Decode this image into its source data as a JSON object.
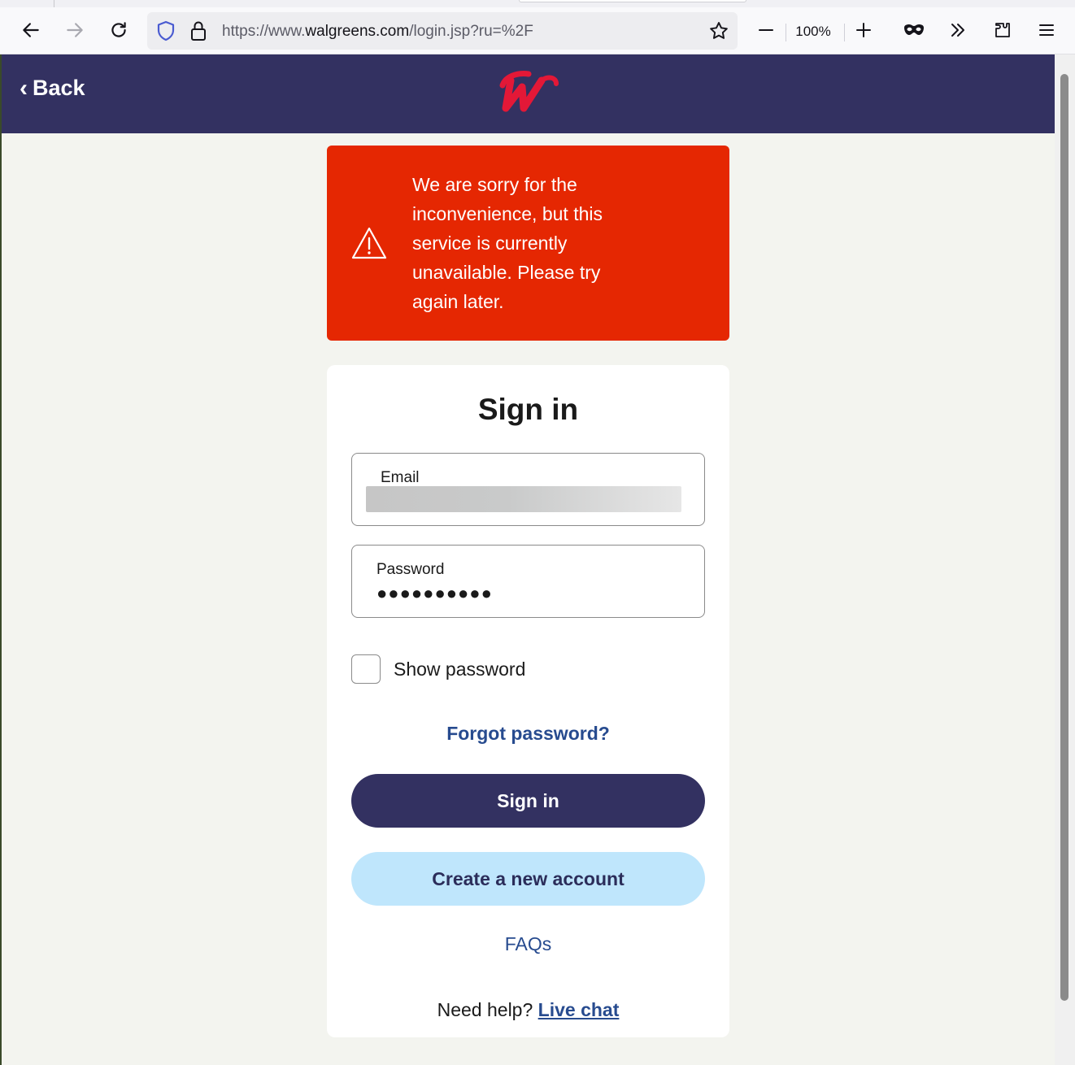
{
  "browser": {
    "url_prefix": "https://www.",
    "url_host": "walgreens.com",
    "url_path": "/login.jsp?ru=%2F",
    "zoom": "100%",
    "icons": [
      "back-arrow-icon",
      "forward-arrow-icon",
      "reload-icon",
      "shield-icon",
      "lock-icon",
      "star-icon",
      "zoom-out-icon",
      "zoom-in-icon",
      "private-mask-icon",
      "overflow-chevrons-icon",
      "extensions-icon",
      "menu-icon"
    ]
  },
  "header": {
    "back_label": "Back",
    "back_chevron": "‹",
    "brand_color": "#333161",
    "logo_color": "#e31837"
  },
  "alert": {
    "message": "We are sorry for the inconvenience, but this service is currently unavailable. Please try again later.",
    "color": "#e52702",
    "icon": "warning-triangle-icon"
  },
  "signin": {
    "title": "Sign in",
    "email_label": "Email",
    "email_value": "",
    "password_label": "Password",
    "password_value": "●●●●●●●●●●",
    "show_password_label": "Show password",
    "show_password_checked": false,
    "forgot_label": "Forgot password?",
    "signin_button": "Sign in",
    "create_button": "Create a new account",
    "faqs_label": "FAQs",
    "help_prefix": "Need help?",
    "live_chat_label": "Live chat"
  }
}
